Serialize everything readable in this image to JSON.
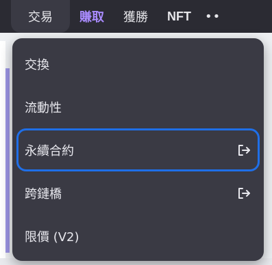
{
  "nav": {
    "items": [
      {
        "label": "交易"
      },
      {
        "label": "賺取"
      },
      {
        "label": "獲勝"
      },
      {
        "label": "NFT"
      }
    ],
    "more": "••"
  },
  "menu": {
    "items": [
      {
        "label": "交換",
        "external": false
      },
      {
        "label": "流動性",
        "external": false
      },
      {
        "label": "永續合約",
        "external": true
      },
      {
        "label": "跨鏈橋",
        "external": true
      },
      {
        "label": "限價 (V2)",
        "external": false
      }
    ]
  },
  "colors": {
    "nav_bg": "#2b2b33",
    "dropdown_bg": "#3a3a44",
    "accent_purple": "#a98bff",
    "focus_ring": "#1f6fe8"
  }
}
